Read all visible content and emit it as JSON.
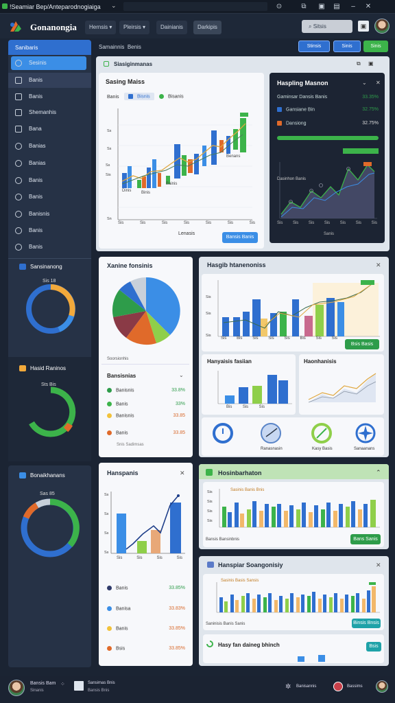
{
  "window": {
    "title": "!Seamiar Bep/Anteparodnogiaiga"
  },
  "app": {
    "name": "Gonanongia"
  },
  "menus": [
    "Hernsis ▾",
    "Pleirsis ▾",
    "Dainianis",
    "Darkipis"
  ],
  "search": {
    "label": "Sitsis"
  },
  "toolbar": {
    "btn1": "Stinsis",
    "btn2": "Sinis",
    "btn3": "Sinis"
  },
  "breadcrumb": {
    "a": "Samainnis",
    "b": "Benis"
  },
  "sidebar": {
    "header": "Sanibaris",
    "items": [
      "Sesinis",
      "Banis",
      "Banis",
      "Shemanhis",
      "Bana",
      "Banias",
      "Banias",
      "Banis",
      "Banis",
      "Banisnis",
      "Banis"
    ]
  },
  "sidepanels": {
    "p1": "Sansinanong",
    "p1_label": "Sis 18",
    "p2": "Hasid Raninos",
    "p2_label": "Sts Bis",
    "p3": "Bonaikhanans",
    "p3_label": "Sas 85"
  },
  "card_main": {
    "title": "Siasiginmanas",
    "sub": "Sasing Maiss",
    "legend1": "Banis",
    "legend2": "Bisnis",
    "legend3": "Bisanis",
    "xlabel": "Lenasis",
    "btn": "Bansis Banis",
    "ann": [
      "Dinis",
      "Binis",
      "Bainis",
      "Benans"
    ],
    "ticks": [
      "Sis",
      "Sis",
      "Sis",
      "Sis",
      "Sis",
      "Sis",
      "Sis"
    ]
  },
  "card_dark": {
    "title": "Haspling Masnon",
    "rows": [
      {
        "label": "Gaminsar Dansis Banis",
        "value": "33.35%"
      },
      {
        "label": "Gansiane Bin",
        "value": "32.75%"
      },
      {
        "label": "Dansiong",
        "value": "32.75%"
      }
    ],
    "sub": "Dasinhon Banis",
    "xlabel": "Sanis",
    "ticks": [
      "Sis",
      "Sis",
      "Sis",
      "Sis",
      "Sis",
      "Sis",
      "Sis"
    ]
  },
  "card_pie": {
    "title": "Xanine fonsinis",
    "sub": "Soorsionhis",
    "list_title": "Bansisnias",
    "items": [
      {
        "label": "Banisnis",
        "value": "33.8%"
      },
      {
        "label": "Banis",
        "value": "33%"
      },
      {
        "label": "Banisnis",
        "value": "33.85"
      },
      {
        "label": "Banis",
        "value": "33.85"
      }
    ],
    "foot": "Snis Sadimsas"
  },
  "card_hist": {
    "title": "Hasgib htanenoniss",
    "btn": "Bsis Basis",
    "ticks": [
      "Sis",
      "Bis",
      "Sis",
      "Sis",
      "Sis",
      "Bis",
      "Sis",
      "Sis"
    ]
  },
  "card_small1": {
    "title": "Hanyaisis fasiian",
    "ticks": [
      "Bis",
      "Sis",
      "Sis"
    ]
  },
  "card_small2": {
    "title": "Haonhanisis"
  },
  "card_icons": {
    "a": "Ranasnasin",
    "b": "Kasy Basis",
    "c": "Sanaanans"
  },
  "card_mid": {
    "title": "Hanspanis",
    "ticks": [
      "Sis",
      "Sis",
      "Sis",
      "Sis"
    ],
    "items": [
      {
        "label": "Banis",
        "value": "33.85%"
      },
      {
        "label": "Banisa",
        "value": "33.83%"
      },
      {
        "label": "Banis",
        "value": "33.85%"
      },
      {
        "label": "Bsis",
        "value": "33.85%"
      }
    ]
  },
  "card_green": {
    "title": "Hosinbarhaton",
    "legend": "Sasinis Banis Bnis",
    "foot": "Bansis Bansinbnis",
    "btn": "Bans Sanis"
  },
  "card_bottom": {
    "title": "Hanspiar Soangonisiy",
    "legend": "Sasinis Basis Sansis",
    "foot": "Saninisis Banis Sanis",
    "btn": "Binsis Bnsis"
  },
  "card_bottom2": {
    "title": "Hasy fan daineg bhinch",
    "btn": "Bsis"
  },
  "footer": {
    "user": "Bansis Bam",
    "sub": "Sinanis",
    "r1": "Sansimas Bnis",
    "r2": "Bansis Bnis",
    "r3": "Banisannis",
    "r4": "Bassims"
  },
  "colors": {
    "blue": "#2f6fcf",
    "green": "#3cb34a",
    "orange": "#e06a2a",
    "accent": "#3b8ee6"
  }
}
